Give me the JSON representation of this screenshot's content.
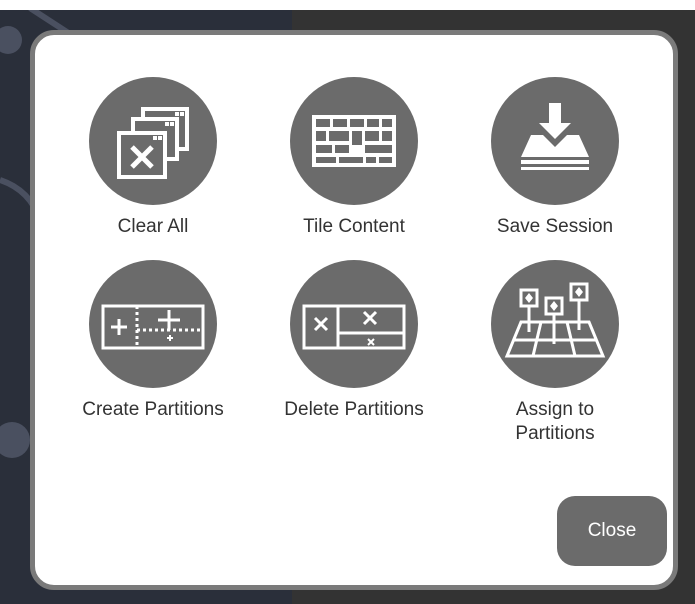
{
  "dialog": {
    "actions": [
      {
        "label": "Clear All",
        "icon": "clear-all-icon"
      },
      {
        "label": "Tile Content",
        "icon": "tile-content-icon"
      },
      {
        "label": "Save Session",
        "icon": "save-session-icon"
      },
      {
        "label": "Create Partitions",
        "icon": "create-partitions-icon"
      },
      {
        "label": "Delete Partitions",
        "icon": "delete-partitions-icon"
      },
      {
        "label": "Assign to Partitions",
        "icon": "assign-partitions-icon"
      }
    ],
    "close_label": "Close"
  },
  "colors": {
    "icon_circle": "#6b6b6b",
    "dialog_border": "#7a7a7a",
    "backdrop": "#2a2f3a"
  }
}
